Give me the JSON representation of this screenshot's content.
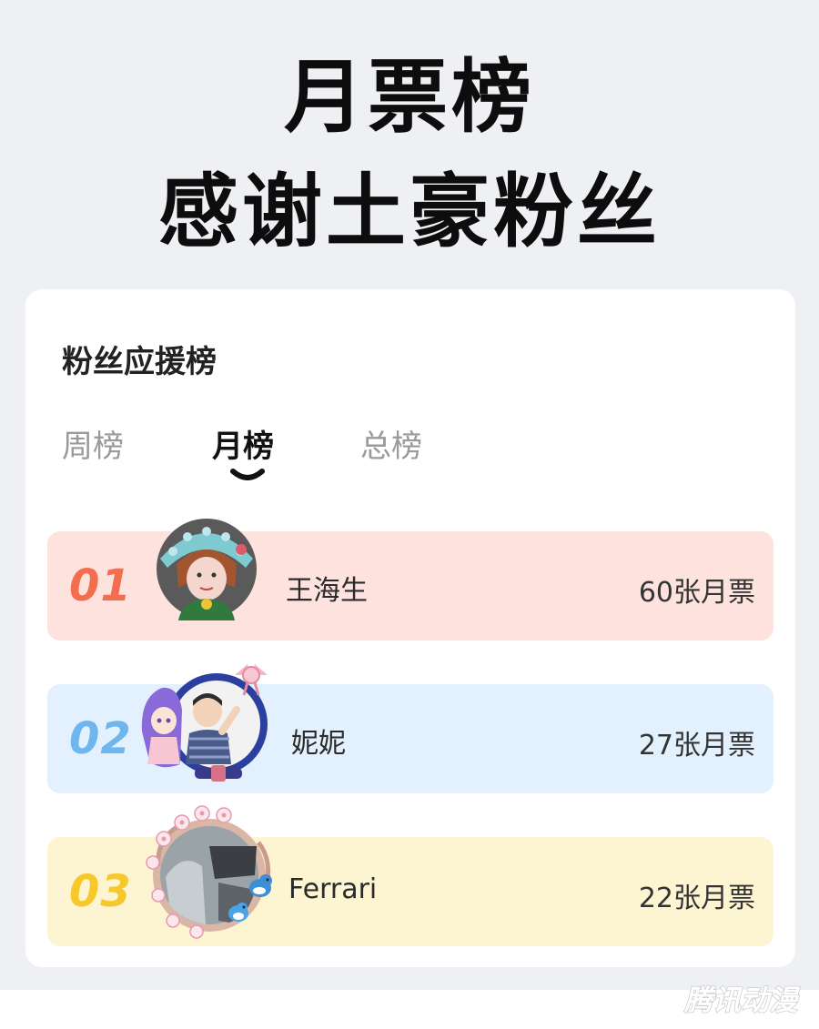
{
  "header": {
    "title_line1": "月票榜",
    "title_line2": "感谢土豪粉丝"
  },
  "panel": {
    "title": "粉丝应援榜",
    "tabs": [
      {
        "label": "周榜",
        "active": false
      },
      {
        "label": "月榜",
        "active": true
      },
      {
        "label": "总榜",
        "active": false
      }
    ]
  },
  "ranking": [
    {
      "rank": "01",
      "name": "王海生",
      "votes": "60张月票",
      "row_color": "#fde2de",
      "rank_color": "#f26e4f",
      "avatar": "cartoon-girl-avatar"
    },
    {
      "rank": "02",
      "name": "妮妮",
      "votes": "27张月票",
      "row_color": "#e3f0fd",
      "rank_color": "#6fb6ee",
      "avatar": "baby-photo-avatar-with-anime-frame"
    },
    {
      "rank": "03",
      "name": "Ferrari",
      "votes": "22张月票",
      "row_color": "#fdf4d2",
      "rank_color": "#f6c82c",
      "avatar": "photo-avatar-with-flower-bird-frame"
    }
  ],
  "watermark": {
    "text": "腾讯动漫"
  },
  "colors": {
    "page_background": "#eff0f4",
    "card": "#ffffff",
    "title": "#0d0d0d"
  }
}
